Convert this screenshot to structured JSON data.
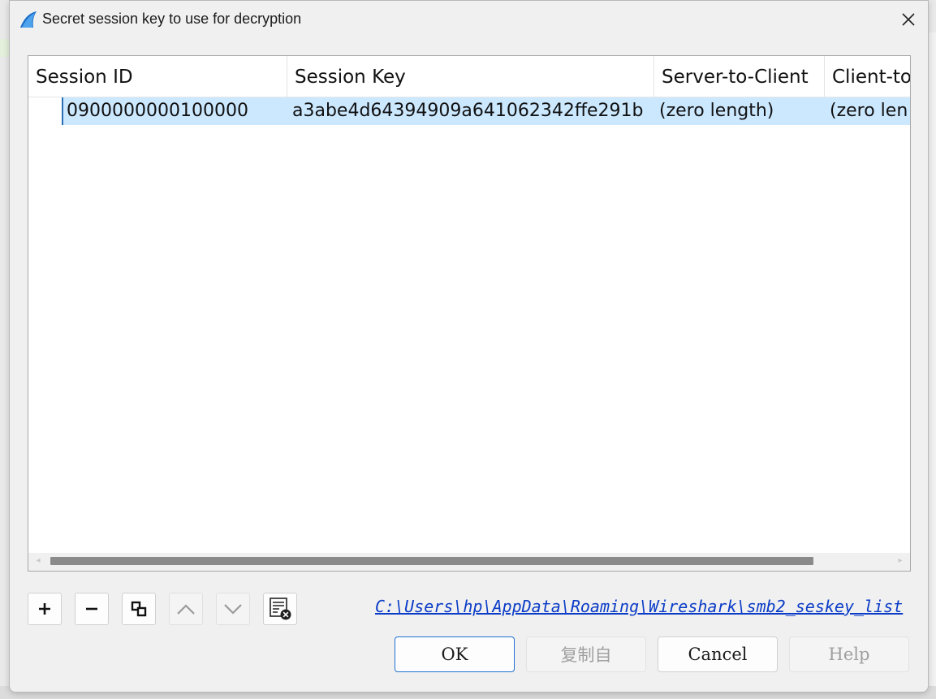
{
  "window": {
    "title": "Secret session key to use for decryption",
    "app_icon": "wireshark-fin-icon",
    "close_icon": "close-icon"
  },
  "table": {
    "columns": [
      "Session ID",
      "Session Key",
      "Server-to-Client",
      "Client-to"
    ],
    "rows": [
      [
        "0900000000100000",
        "a3abe4d64394909a641062342ffe291b",
        "(zero length)",
        "(zero len"
      ]
    ]
  },
  "toolbar": {
    "add_icon": "plus-icon",
    "remove_icon": "minus-icon",
    "copy_icon": "copy-icon",
    "move_up_icon": "chevron-up-icon",
    "move_down_icon": "chevron-down-icon",
    "clear_icon": "clear-list-icon"
  },
  "file_path": "C:\\Users\\hp\\AppData\\Roaming\\Wireshark\\smb2_seskey_list",
  "buttons": {
    "ok": "OK",
    "copy_from": "复制自",
    "cancel": "Cancel",
    "help": "Help"
  },
  "colors": {
    "selection": "#cce8ff",
    "link": "#0b3cc7",
    "default_button_border": "#1f6fd0"
  }
}
